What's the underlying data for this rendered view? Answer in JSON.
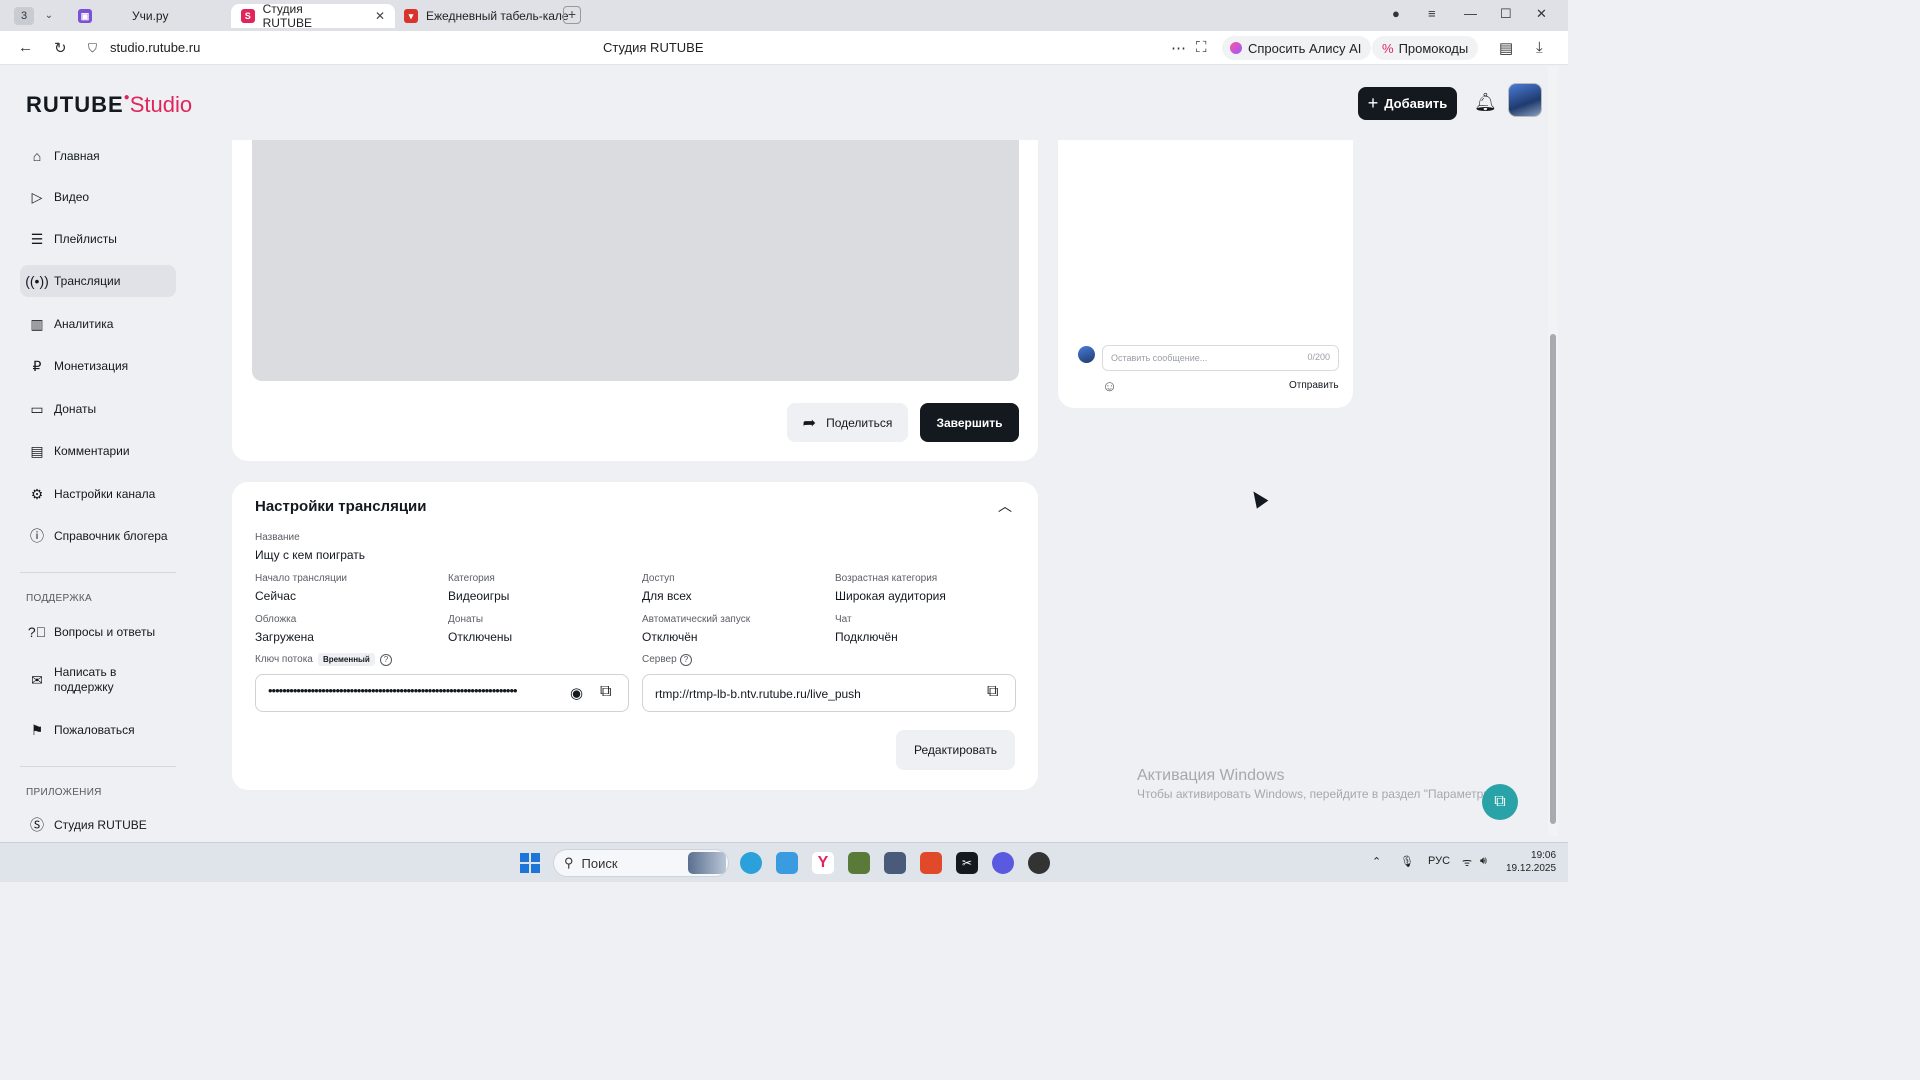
{
  "browser": {
    "tab_count": "3",
    "tabs": [
      {
        "label": "Учи.ру"
      },
      {
        "label": "Студия RUTUBE"
      },
      {
        "label": "Ежедневный табель-кале"
      }
    ],
    "url": "studio.rutube.ru",
    "page_title": "Студия RUTUBE",
    "alice_label": "Спросить Алису AI",
    "promo_label": "Промокоды"
  },
  "header": {
    "logo_main": "RUTUBE",
    "logo_sub": "Studio",
    "add_label": "Добавить"
  },
  "sidebar": {
    "items": [
      {
        "label": "Главная",
        "icon": "home-icon"
      },
      {
        "label": "Видео",
        "icon": "video-icon"
      },
      {
        "label": "Плейлисты",
        "icon": "playlist-icon"
      },
      {
        "label": "Трансляции",
        "icon": "broadcast-icon"
      },
      {
        "label": "Аналитика",
        "icon": "analytics-icon"
      },
      {
        "label": "Монетизация",
        "icon": "ruble-icon"
      },
      {
        "label": "Донаты",
        "icon": "wallet-icon"
      },
      {
        "label": "Комментарии",
        "icon": "comment-icon"
      },
      {
        "label": "Настройки канала",
        "icon": "gear-icon"
      },
      {
        "label": "Справочник блогера",
        "icon": "info-icon"
      }
    ],
    "support_label": "ПОДДЕРЖКА",
    "support_items": [
      {
        "label": "Вопросы и ответы",
        "icon": "question-icon"
      },
      {
        "label": "Написать в поддержку",
        "icon": "mail-icon"
      },
      {
        "label": "Пожаловаться",
        "icon": "flag-icon"
      }
    ],
    "apps_label": "ПРИЛОЖЕНИЯ",
    "apps_items": [
      {
        "label": "Студия RUTUBE",
        "icon": "studio-icon"
      }
    ]
  },
  "stream": {
    "share_label": "Поделиться",
    "finish_label": "Завершить"
  },
  "settings": {
    "title": "Настройки трансляции",
    "name_label": "Название",
    "name_value": "Ищу с кем поиграть",
    "start_label": "Начало трансляции",
    "start_value": "Сейчас",
    "category_label": "Категория",
    "category_value": "Видеоигры",
    "access_label": "Доступ",
    "access_value": "Для всех",
    "age_label": "Возрастная категория",
    "age_value": "Широкая аудитория",
    "cover_label": "Обложка",
    "cover_value": "Загружена",
    "donations_label": "Донаты",
    "donations_value": "Отключены",
    "autostart_label": "Автоматический запуск",
    "autostart_value": "Отключён",
    "chat_label": "Чат",
    "chat_value": "Подключён",
    "key_label": "Ключ потока",
    "key_badge": "Временный",
    "key_value": "••••••••••••••••••••••••••••••••••••••••••••••••••••••••••••••••••••••",
    "server_label": "Сервер",
    "server_value": "rtmp://rtmp-lb-b.ntv.rutube.ru/live_push",
    "edit_label": "Редактировать"
  },
  "chat": {
    "placeholder": "Оставить сообщение...",
    "counter": "0/200",
    "send_label": "Отправить"
  },
  "watermark": {
    "title": "Активация Windows",
    "subtitle": "Чтобы активировать Windows, перейдите в раздел \"Параметры\"."
  },
  "taskbar": {
    "search_label": "Поиск",
    "lang": "РУС",
    "time": "19:06",
    "date": "19.12.2025"
  }
}
